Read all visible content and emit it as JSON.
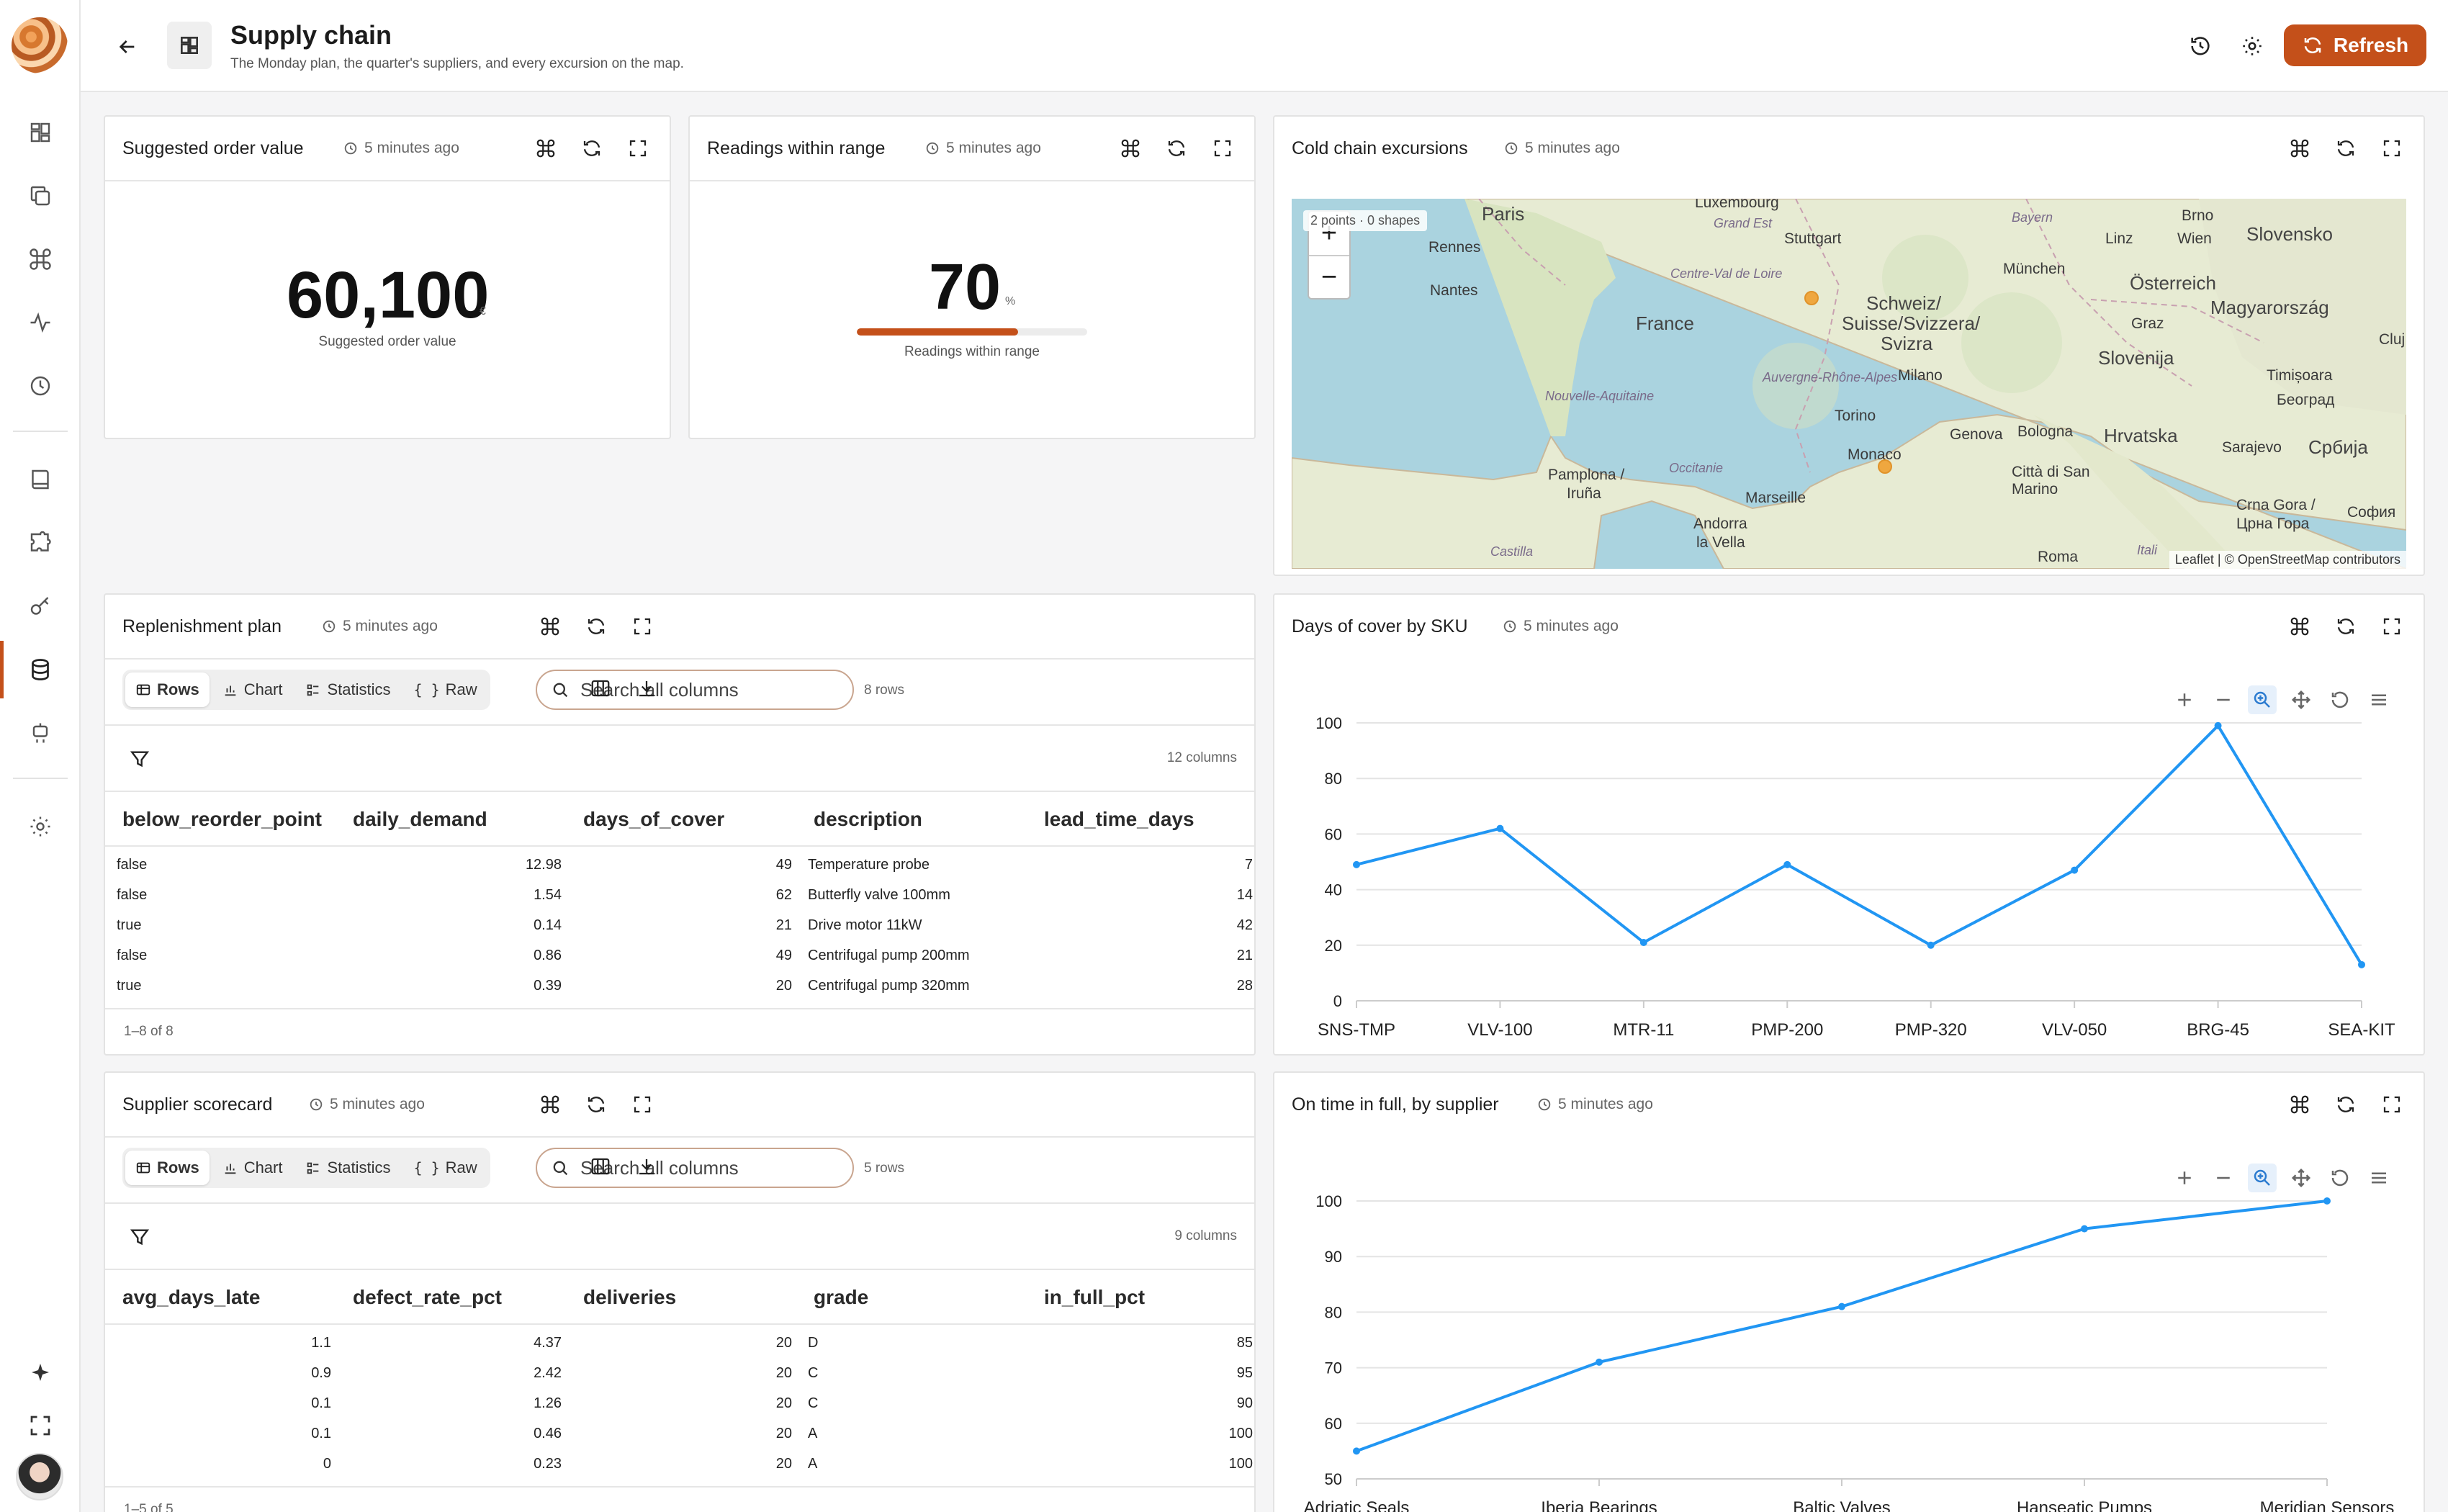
{
  "header": {
    "title": "Supply chain",
    "subtitle": "The Monday plan, the quarter's suppliers, and every excursion on the map.",
    "refresh_label": "Refresh"
  },
  "colors": {
    "accent": "#c4501a",
    "series": "#2196f3"
  },
  "panels": {
    "suggested": {
      "title": "Suggested order value",
      "time": "5 minutes ago",
      "value": "60,100",
      "unit": "€",
      "label": "Suggested order value"
    },
    "readings": {
      "title": "Readings within range",
      "time": "5 minutes ago",
      "value": "70",
      "unit": "%",
      "label": "Readings within range",
      "fill_fraction": 0.7
    },
    "map": {
      "title": "Cold chain excursions",
      "time": "5 minutes ago",
      "info": "2 points · 0 shapes",
      "zoom_in": "+",
      "zoom_out": "−",
      "attribution": "Leaflet | © OpenStreetMap contributors",
      "labels": [
        "Paris",
        "Luxembourg",
        "Grand Est",
        "Bayern",
        "Brno",
        "Rennes",
        "Stuttgart",
        "Linz",
        "Wien",
        "Slovensko",
        "Nantes",
        "Centre-Val de Loire",
        "München",
        "Österreich",
        "France",
        "Schweiz/",
        "Suisse/Svizzera/",
        "Svizra",
        "Graz",
        "Magyarország",
        "Slovenija",
        "Cluj",
        "Nouvelle-Aquitaine",
        "Auvergne-Rhône-Alpes",
        "Milano",
        "Timișoara",
        "Београд",
        "Torino",
        "Genova",
        "Bologna",
        "Hrvatska",
        "Occitanie",
        "Monaco",
        "Pamplona /",
        "Iruña",
        "Città di San Marino",
        "Sarajevo",
        "Србија",
        "Marseille",
        "Crna Gora /",
        "Црна Гора",
        "София",
        "Andorra",
        "la Vella",
        "Castilla",
        "Itali",
        "Roma"
      ]
    },
    "replenishment": {
      "title": "Replenishment plan",
      "time": "5 minutes ago",
      "tabs": [
        "Rows",
        "Chart",
        "Statistics",
        "Raw"
      ],
      "search_placeholder": "Search all columns",
      "rows_count": "8 rows",
      "columns_count": "12 columns",
      "columns": [
        "below_reorder_point",
        "daily_demand",
        "days_of_cover",
        "description",
        "lead_time_days"
      ],
      "rows": [
        [
          "false",
          "12.98",
          "49",
          "Temperature probe",
          "7"
        ],
        [
          "false",
          "1.54",
          "62",
          "Butterfly valve 100mm",
          "14"
        ],
        [
          "true",
          "0.14",
          "21",
          "Drive motor 11kW",
          "42"
        ],
        [
          "false",
          "0.86",
          "49",
          "Centrifugal pump 200mm",
          "21"
        ],
        [
          "true",
          "0.39",
          "20",
          "Centrifugal pump 320mm",
          "28"
        ]
      ],
      "footer": "1–8 of 8"
    },
    "suppliers": {
      "title": "Supplier scorecard",
      "time": "5 minutes ago",
      "tabs": [
        "Rows",
        "Chart",
        "Statistics",
        "Raw"
      ],
      "search_placeholder": "Search all columns",
      "rows_count": "5 rows",
      "columns_count": "9 columns",
      "columns": [
        "avg_days_late",
        "defect_rate_pct",
        "deliveries",
        "grade",
        "in_full_pct"
      ],
      "rows": [
        [
          "1.1",
          "4.37",
          "20",
          "D",
          "85"
        ],
        [
          "0.9",
          "2.42",
          "20",
          "C",
          "95"
        ],
        [
          "0.1",
          "1.26",
          "20",
          "C",
          "90"
        ],
        [
          "0.1",
          "0.46",
          "20",
          "A",
          "100"
        ],
        [
          "0",
          "0.23",
          "20",
          "A",
          "100"
        ]
      ],
      "footer": "1–5 of 5"
    },
    "cover_chart": {
      "title": "Days of cover by SKU",
      "time": "5 minutes ago"
    },
    "otif_chart": {
      "title": "On time in full, by supplier",
      "time": "5 minutes ago"
    }
  },
  "chart_data": [
    {
      "type": "line",
      "categories": [
        "SNS-TMP",
        "VLV-100",
        "MTR-11",
        "PMP-200",
        "PMP-320",
        "VLV-050",
        "BRG-45",
        "SEA-KIT"
      ],
      "values": [
        49,
        62,
        21,
        49,
        20,
        47,
        99,
        13
      ],
      "ylim": [
        0,
        100
      ],
      "yticks": [
        0,
        20,
        40,
        60,
        80,
        100
      ],
      "grid": true
    },
    {
      "type": "line",
      "categories": [
        "Adriatic Seals",
        "Iberia Bearings",
        "Baltic Valves",
        "Hanseatic Pumps",
        "Meridian Sensors"
      ],
      "values": [
        55,
        71,
        81,
        95,
        100
      ],
      "ylim": [
        50,
        100
      ],
      "yticks": [
        50,
        60,
        70,
        80,
        90,
        100
      ],
      "grid": true
    }
  ]
}
